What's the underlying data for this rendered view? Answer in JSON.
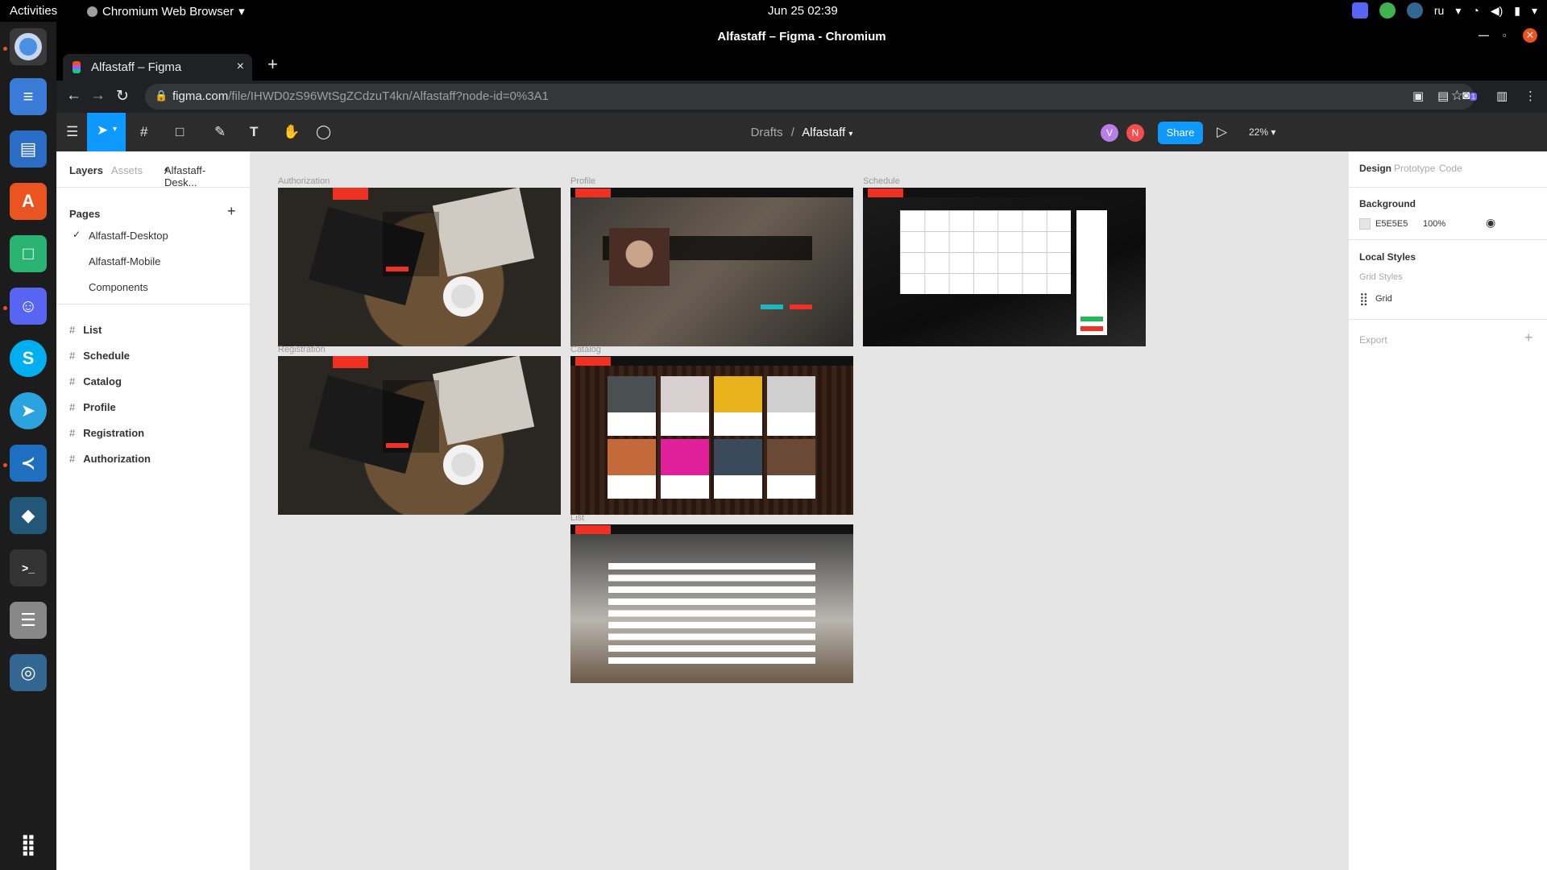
{
  "os": {
    "activities": "Activities",
    "app_name": "Chromium Web Browser",
    "clock": "Jun 25  02:39",
    "lang": "ru"
  },
  "browser": {
    "window_title": "Alfastaff – Figma - Chromium",
    "tab_title": "Alfastaff – Figma",
    "url_host": "figma.com",
    "url_path": "/file/IHWD0zS96WtSgZCdzuT4kn/Alfastaff?node-id=0%3A1",
    "ext_badge": "1"
  },
  "figma": {
    "breadcrumb_parent": "Drafts",
    "breadcrumb_sep": "/",
    "file_name": "Alfastaff",
    "avatars": [
      "V",
      "N"
    ],
    "share_label": "Share",
    "zoom": "22%",
    "left": {
      "tab_layers": "Layers",
      "tab_assets": "Assets",
      "page_select": "Alfastaff-Desk...",
      "pages_title": "Pages",
      "pages": [
        "Alfastaff-Desktop",
        "Alfastaff-Mobile",
        "Components"
      ],
      "layers": [
        "List",
        "Schedule",
        "Catalog",
        "Profile",
        "Registration",
        "Authorization"
      ]
    },
    "right": {
      "tab_design": "Design",
      "tab_prototype": "Prototype",
      "tab_code": "Code",
      "background_title": "Background",
      "bg_hex": "E5E5E5",
      "bg_opacity": "100%",
      "local_styles_title": "Local Styles",
      "grid_styles": "Grid Styles",
      "grid_name": "Grid",
      "export_title": "Export"
    },
    "frames": {
      "authorization": "Authorization",
      "profile": "Profile",
      "schedule": "Schedule",
      "registration": "Registration",
      "catalog": "Catalog",
      "list": "List"
    },
    "help": "?",
    "canvas_bg": "#e5e5e5",
    "accent": "#0d99ff",
    "brand_red": "#ef3124"
  }
}
